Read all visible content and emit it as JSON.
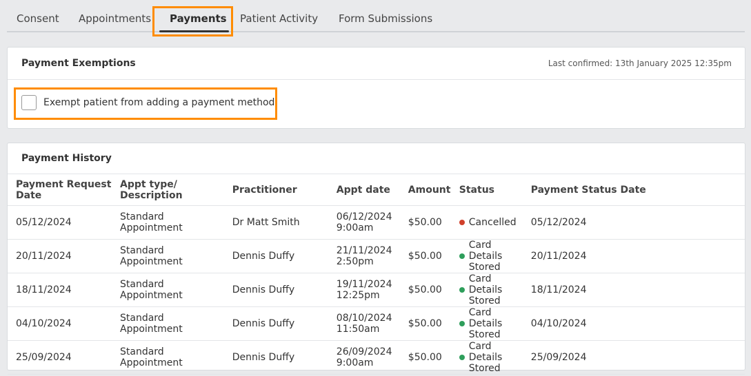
{
  "tabs": [
    {
      "label": "Consent"
    },
    {
      "label": "Appointments"
    },
    {
      "label": "Payments",
      "active": true
    },
    {
      "label": "Patient Activity"
    },
    {
      "label": "Form Submissions"
    }
  ],
  "exemptions": {
    "title": "Payment Exemptions",
    "last_confirmed": "Last confirmed: 13th January 2025 12:35pm",
    "checkbox_label": "Exempt patient from adding a payment method",
    "checked": false
  },
  "history": {
    "title": "Payment History",
    "columns": [
      "Payment Request Date",
      "Appt type/ Description",
      "Practitioner",
      "Appt date",
      "Amount",
      "Status",
      "Payment Status Date"
    ],
    "rows": [
      {
        "request_date": "05/12/2024",
        "appt_type": "Standard Appointment",
        "practitioner": "Dr Matt Smith",
        "appt_date": "06/12/2024 9:00am",
        "amount": "$50.00",
        "status": "Cancelled",
        "status_color": "#d0402b",
        "status_date": "05/12/2024"
      },
      {
        "request_date": "20/11/2024",
        "appt_type": "Standard Appointment",
        "practitioner": "Dennis Duffy",
        "appt_date": "21/11/2024 2:50pm",
        "amount": "$50.00",
        "status": "Card Details Stored",
        "status_color": "#2e9e5b",
        "status_date": "20/11/2024"
      },
      {
        "request_date": "18/11/2024",
        "appt_type": "Standard Appointment",
        "practitioner": "Dennis Duffy",
        "appt_date": "19/11/2024 12:25pm",
        "amount": "$50.00",
        "status": "Card Details Stored",
        "status_color": "#2e9e5b",
        "status_date": "18/11/2024"
      },
      {
        "request_date": "04/10/2024",
        "appt_type": "Standard Appointment",
        "practitioner": "Dennis Duffy",
        "appt_date": "08/10/2024 11:50am",
        "amount": "$50.00",
        "status": "Card Details Stored",
        "status_color": "#2e9e5b",
        "status_date": "04/10/2024"
      },
      {
        "request_date": "25/09/2024",
        "appt_type": "Standard Appointment",
        "practitioner": "Dennis Duffy",
        "appt_date": "26/09/2024 9:00am",
        "amount": "$50.00",
        "status": "Card Details Stored",
        "status_color": "#2e9e5b",
        "status_date": "25/09/2024"
      }
    ]
  },
  "colors": {
    "highlight": "#ff8c00",
    "cancelled": "#d0402b",
    "stored": "#2e9e5b"
  }
}
